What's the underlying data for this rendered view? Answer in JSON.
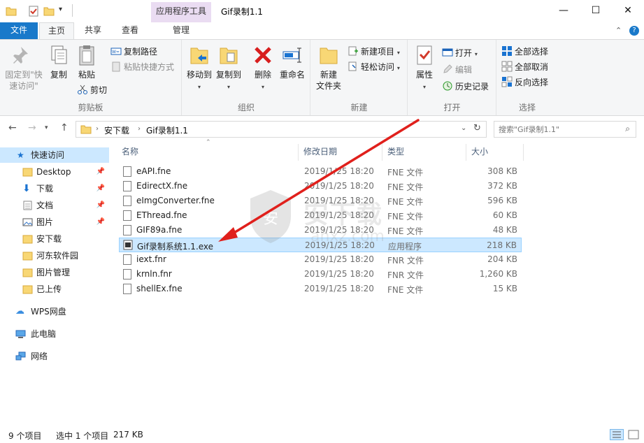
{
  "window": {
    "title": "Gif录制1.1",
    "context_tab_label": "应用程序工具"
  },
  "tabs": {
    "file": "文件",
    "home": "主页",
    "share": "共享",
    "view": "查看",
    "manage": "管理"
  },
  "ribbon": {
    "clipboard": {
      "label": "剪贴板",
      "pin": "固定到\"快速访问\"",
      "copy": "复制",
      "paste": "粘贴",
      "copy_path": "复制路径",
      "paste_shortcut": "粘贴快捷方式",
      "cut": "剪切"
    },
    "organize": {
      "label": "组织",
      "move_to": "移动到",
      "copy_to": "复制到",
      "delete": "删除",
      "rename": "重命名"
    },
    "new": {
      "label": "新建",
      "new_folder": "新建\n文件夹",
      "new_item": "新建项目",
      "easy_access": "轻松访问"
    },
    "open": {
      "label": "打开",
      "properties": "属性",
      "open": "打开",
      "edit": "编辑",
      "history": "历史记录"
    },
    "select": {
      "label": "选择",
      "select_all": "全部选择",
      "select_none": "全部取消",
      "invert": "反向选择"
    }
  },
  "address": {
    "crumbs": [
      "安下载",
      "Gif录制1.1"
    ],
    "search_placeholder": "搜索\"Gif录制1.1\""
  },
  "nav": {
    "quick_access": "快速访问",
    "items": [
      "Desktop",
      "下载",
      "文档",
      "图片",
      "安下载",
      "河东软件园",
      "图片管理",
      "已上传"
    ],
    "wps": "WPS网盘",
    "this_pc": "此电脑",
    "network": "网络"
  },
  "columns": {
    "name": "名称",
    "date": "修改日期",
    "type": "类型",
    "size": "大小"
  },
  "files": [
    {
      "name": "eAPI.fne",
      "date": "2019/1/25 18:20",
      "type": "FNE 文件",
      "size": "308 KB"
    },
    {
      "name": "EdirectX.fne",
      "date": "2019/1/25 18:20",
      "type": "FNE 文件",
      "size": "372 KB"
    },
    {
      "name": "eImgConverter.fne",
      "date": "2019/1/25 18:20",
      "type": "FNE 文件",
      "size": "596 KB"
    },
    {
      "name": "EThread.fne",
      "date": "2019/1/25 18:20",
      "type": "FNE 文件",
      "size": "60 KB"
    },
    {
      "name": "GIF89a.fne",
      "date": "2019/1/25 18:20",
      "type": "FNE 文件",
      "size": "48 KB"
    },
    {
      "name": "Gif录制系统1.1.exe",
      "date": "2019/1/25 18:20",
      "type": "应用程序",
      "size": "218 KB"
    },
    {
      "name": "iext.fnr",
      "date": "2019/1/25 18:20",
      "type": "FNR 文件",
      "size": "204 KB"
    },
    {
      "name": "krnln.fnr",
      "date": "2019/1/25 18:20",
      "type": "FNR 文件",
      "size": "1,260 KB"
    },
    {
      "name": "shellEx.fne",
      "date": "2019/1/25 18:20",
      "type": "FNE 文件",
      "size": "15 KB"
    }
  ],
  "status": {
    "count": "9 个项目",
    "selection": "选中 1 个项目",
    "size": "217 KB"
  },
  "watermark": {
    "text": "安下载",
    "url": "anxz.com"
  },
  "colors": {
    "accent": "#1979ca",
    "selection": "#cce8ff",
    "annotation_arrow": "#e0201c"
  }
}
